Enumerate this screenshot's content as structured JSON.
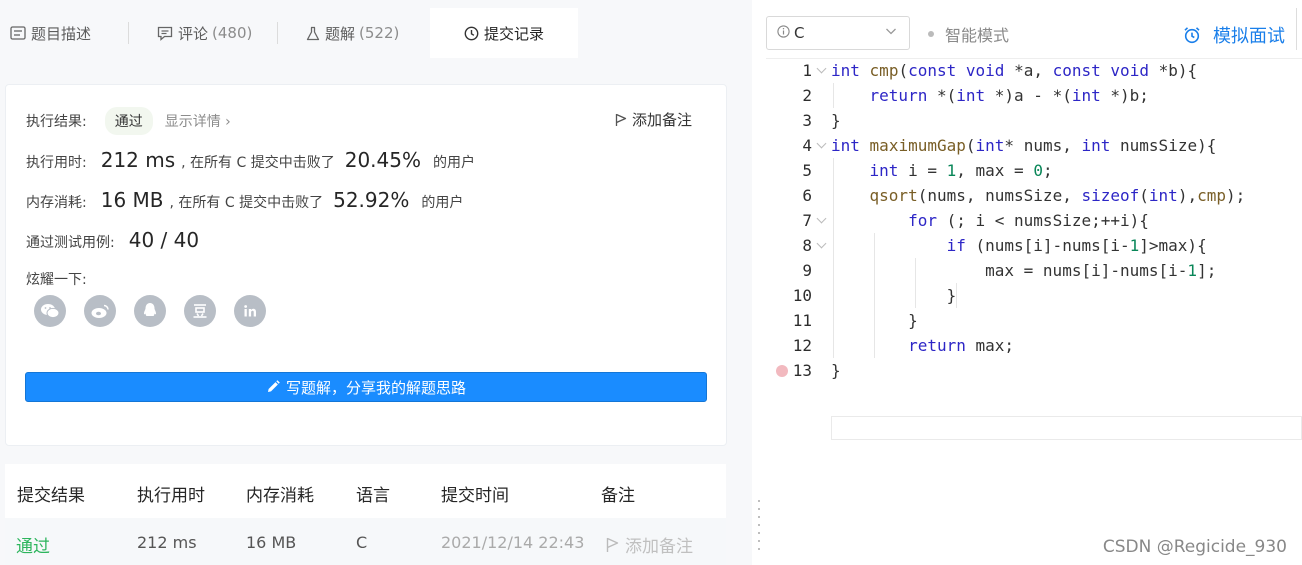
{
  "tabs": [
    {
      "label": "题目描述",
      "count": "",
      "icon": "description-icon"
    },
    {
      "label": "评论",
      "count": "(480)",
      "icon": "comment-icon"
    },
    {
      "label": "题解",
      "count": "(522)",
      "icon": "flask-icon"
    },
    {
      "label": "提交记录",
      "count": "",
      "icon": "clock-icon"
    }
  ],
  "result": {
    "status_label": "执行结果:",
    "status_value": "通过",
    "detail_link": "显示详情 ›",
    "add_note": "添加备注",
    "runtime_label": "执行用时:",
    "runtime_value": "212 ms",
    "runtime_text": ", 在所有 C 提交中击败了",
    "runtime_percent": "20.45%",
    "runtime_suffix": "的用户",
    "memory_label": "内存消耗:",
    "memory_value": "16 MB",
    "memory_text": ", 在所有 C 提交中击败了",
    "memory_percent": "52.92%",
    "memory_suffix": "的用户",
    "testcases_label": "通过测试用例:",
    "testcases_value": "40 / 40",
    "share_label": "炫耀一下:",
    "share_icons": [
      "wechat-icon",
      "weibo-icon",
      "qq-icon",
      "douban-icon",
      "linkedin-icon"
    ],
    "write_solution": "写题解，分享我的解题思路"
  },
  "submissions": {
    "headers": [
      "提交结果",
      "执行用时",
      "内存消耗",
      "语言",
      "提交时间",
      "备注"
    ],
    "rows": [
      {
        "result": "通过",
        "runtime": "212 ms",
        "memory": "16 MB",
        "language": "C",
        "time": "2021/12/14 22:43",
        "note": "添加备注"
      }
    ]
  },
  "editor": {
    "language": "C",
    "smart_mode": "智能模式",
    "mock_interview": "模拟面试",
    "line_numbers": [
      "1",
      "2",
      "3",
      "4",
      "5",
      "6",
      "7",
      "8",
      "9",
      "10",
      "11",
      "12",
      "13"
    ],
    "code_lines": [
      "int cmp(const void *a, const void *b){",
      "    return *(int *)a - *(int *)b;",
      "}",
      "int maximumGap(int* nums, int numsSize){",
      "    int i = 1, max = 0;",
      "    qsort(nums, numsSize, sizeof(int),cmp);",
      "        for (; i < numsSize;++i){",
      "            if (nums[i]-nums[i-1]>max){",
      "                max = nums[i]-nums[i-1];",
      "            }",
      "        }",
      "        return max;",
      "}"
    ]
  },
  "watermark": "CSDN @Regicide_930",
  "colors": {
    "accent": "#1a8cff",
    "pass": "#2db55d",
    "keyword": "#2d26c6",
    "function": "#795e26",
    "number": "#098658"
  }
}
